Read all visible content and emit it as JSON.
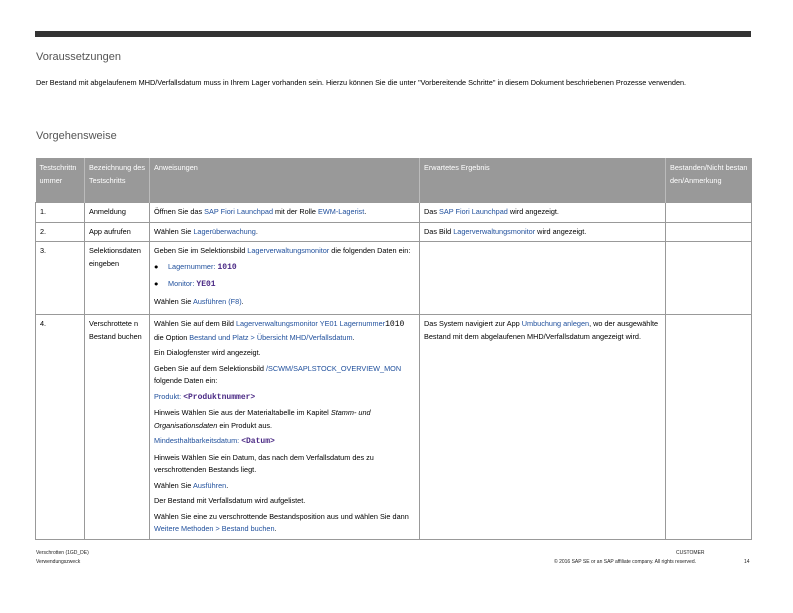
{
  "section1": {
    "heading": "Voraussetzungen",
    "text": "Der Bestand mit abgelaufenem MHD/Verfallsdatum muss in Ihrem Lager vorhanden sein. Hierzu können Sie die unter \"Vorbereitende Schritte\" in diesem Dokument beschriebenen Prozesse verwenden."
  },
  "section2": {
    "heading": "Vorgehensweise"
  },
  "table": {
    "headers": {
      "nr": "Testschrittnummer",
      "name": "Bezeichnung des Testschritts",
      "instr": "Anweisungen",
      "result": "Erwartetes Ergebnis",
      "status": "Bestanden/Nicht bestanden/Anmerkung"
    },
    "rows": [
      {
        "nr": "1.",
        "name": "Anmeldung",
        "instr": {
          "p1": "Öffnen Sie das ",
          "l1": "SAP Fiori Launchpad",
          "p2": " mit der Rolle ",
          "l2": "EWM-Lagerist",
          "p3": "."
        },
        "result": {
          "p1": "Das ",
          "l1": "SAP Fiori Launchpad",
          "p2": " wird angezeigt."
        }
      },
      {
        "nr": "2.",
        "name": "App aufrufen",
        "instr": {
          "p1": "Wählen Sie ",
          "l1": "Lagerüberwachung",
          "p2": "."
        },
        "result": {
          "p1": "Das Bild ",
          "l1": "Lagerverwaltungsmonitor",
          "p2": " wird angezeigt."
        }
      },
      {
        "nr": "3.",
        "name": "Selektionsdaten eingeben",
        "instr": {
          "p1": "Geben Sie im Selektionsbild ",
          "l1": "Lagerverwaltungsmonitor",
          "p2": " die folgenden Daten ein:",
          "b1_label": "Lagernummer: ",
          "b1_value": "1010",
          "b2_label": "Monitor: ",
          "b2_value": "YE01",
          "p3": "Wählen Sie ",
          "l2": "Ausführen (F8)",
          "p4": "."
        },
        "result": {}
      },
      {
        "nr": "4.",
        "name": "Verschrottete n Bestand buchen",
        "instr": {
          "a1": "Wählen Sie auf dem Bild ",
          "a2": "Lagerverwaltungsmonitor YE01",
          "a3": "Lagernummer",
          "a4": "1010",
          "a5": " die Option ",
          "a6": "Bestand und Platz > Übersicht MHD/Verfallsdatum",
          "a7": ".",
          "b": "Ein Dialogfenster wird angezeigt.",
          "c1": "Geben Sie auf dem Selektionsbild ",
          "c2": "/SCWM/SAPLSTOCK_OVERVIEW_MON",
          "c3": " folgende Daten ein:",
          "d1": "Produkt: ",
          "d2": "<Produktnummer>",
          "e1": "Hinweis Wählen Sie aus der Materialtabelle im Kapitel ",
          "e2": "Stamm- und Organisationsdaten",
          "e3": " ein Produkt aus.",
          "f1": "Mindesthaltbarkeitsdatum: ",
          "f2": "<Datum>",
          "g": "Hinweis Wählen Sie ein Datum, das nach dem Verfallsdatum des zu verschrottenden Bestands liegt.",
          "h1": "Wählen Sie ",
          "h2": "Ausführen",
          "h3": ".",
          "i": "Der Bestand mit Verfallsdatum wird aufgelistet.",
          "j1": "Wählen Sie eine zu verschrottende Bestandsposition aus und wählen Sie dann ",
          "j2": "Weitere Methoden > Bestand buchen",
          "j3": "."
        },
        "result": {
          "p1": "Das System navigiert zur App ",
          "l1": "Umbuchung anlegen",
          "p2": ", wo der ausgewählte Bestand mit dem abgelaufenen MHD/Verfallsdatum angezeigt wird."
        }
      }
    ]
  },
  "footer": {
    "left1": "Verschrotten (1GD_DE)",
    "left2": "Verwendungszweck",
    "customer": "CUSTOMER",
    "copyright": "© 2016 SAP SE or an SAP affiliate company. All rights reserved.",
    "page": "14"
  },
  "colors": {
    "link": "#1f4f9c",
    "header_bg": "#999999",
    "mono": "#4b2a85"
  }
}
